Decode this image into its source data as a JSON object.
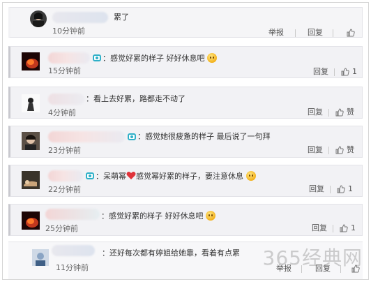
{
  "comments": [
    {
      "text": "累了",
      "time": "10分钟前",
      "actions": [
        "举报",
        "回复"
      ],
      "likes": ""
    },
    {
      "text": "：感觉好累的样子 好好休息吧",
      "time": "15分钟前",
      "actions": [
        "回复"
      ],
      "likes": "1"
    },
    {
      "text": "：看上去好累，路都走不动了",
      "time": "4分钟前",
      "actions": [
        "回复"
      ],
      "likes": "赞"
    },
    {
      "text": "：感觉她很疲惫的样子 最后说了一句拜",
      "time": "23分钟前",
      "actions": [
        "回复"
      ],
      "likes": "赞"
    },
    {
      "text_a": "：呆萌幂",
      "text_b": "感觉幂好累的样子，要注意休息",
      "time": "22分钟前",
      "actions": [
        "回复"
      ],
      "likes": "1"
    },
    {
      "text": "：感觉好累的样子 好好休息吧",
      "time": "25分钟前",
      "actions": [
        "回复"
      ],
      "likes": "1"
    },
    {
      "text": "：还好每次都有婷姐给她靠，看着有点累",
      "time": "11分钟前",
      "actions": [
        "举报",
        "回复"
      ],
      "likes": ""
    }
  ],
  "watermark": "365经典网",
  "colors": {
    "vip": "#2fb0c8",
    "heart": "#e0333a",
    "border": "#c9c9cf"
  },
  "icons": [
    "thumbs-up-icon",
    "vip-icon",
    "emoji-sweat-icon",
    "heart-icon"
  ]
}
